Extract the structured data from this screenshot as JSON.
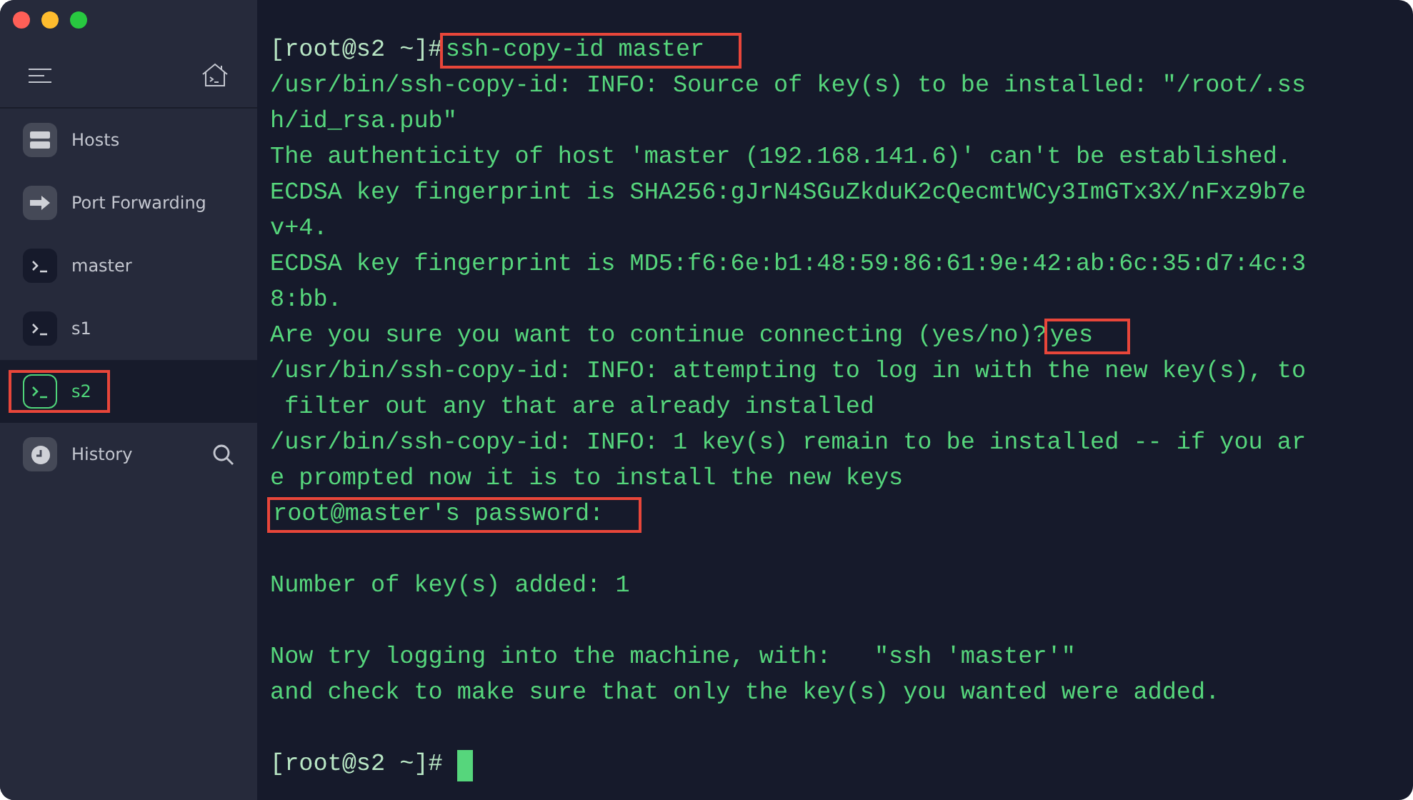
{
  "sidebar": {
    "items": [
      {
        "kind": "hosts",
        "label": "Hosts",
        "selected": false,
        "highlighted": false
      },
      {
        "kind": "forwarding",
        "label": "Port Forwarding",
        "selected": false,
        "highlighted": false
      },
      {
        "kind": "terminal",
        "label": "master",
        "selected": false,
        "highlighted": false
      },
      {
        "kind": "terminal",
        "label": "s1",
        "selected": false,
        "highlighted": false
      },
      {
        "kind": "terminal",
        "label": "s2",
        "selected": true,
        "highlighted": true
      },
      {
        "kind": "history",
        "label": "History",
        "selected": false,
        "highlighted": false
      }
    ]
  },
  "terminal": {
    "lines": [
      {
        "kind": "text",
        "segments": [
          {
            "text": "[root@s2 ~]#",
            "highlighted": false
          },
          {
            "text": "ssh-copy-id master",
            "highlighted": true
          }
        ]
      },
      {
        "kind": "text",
        "segments": [
          {
            "text": "/usr/bin/ssh-copy-id: INFO: Source of key(s) to be installed: \"/root/.ss",
            "highlighted": false
          }
        ]
      },
      {
        "kind": "text",
        "segments": [
          {
            "text": "h/id_rsa.pub\"",
            "highlighted": false
          }
        ]
      },
      {
        "kind": "text",
        "segments": [
          {
            "text": "The authenticity of host 'master (192.168.141.6)' can't be established.",
            "highlighted": false
          }
        ]
      },
      {
        "kind": "text",
        "segments": [
          {
            "text": "ECDSA key fingerprint is SHA256:gJrN4SGuZkduK2cQecmtWCy3ImGTx3X/nFxz9b7e",
            "highlighted": false
          }
        ]
      },
      {
        "kind": "text",
        "segments": [
          {
            "text": "v+4.",
            "highlighted": false
          }
        ]
      },
      {
        "kind": "text",
        "segments": [
          {
            "text": "ECDSA key fingerprint is MD5:f6:6e:b1:48:59:86:61:9e:42:ab:6c:35:d7:4c:3",
            "highlighted": false
          }
        ]
      },
      {
        "kind": "text",
        "segments": [
          {
            "text": "8:bb.",
            "highlighted": false
          }
        ]
      },
      {
        "kind": "text",
        "segments": [
          {
            "text": "Are you sure you want to continue connecting (yes/no)?",
            "highlighted": false
          },
          {
            "text": "yes",
            "highlighted": true
          }
        ]
      },
      {
        "kind": "text",
        "segments": [
          {
            "text": "/usr/bin/ssh-copy-id: INFO: attempting to log in with the new key(s), to",
            "highlighted": false
          }
        ]
      },
      {
        "kind": "text",
        "segments": [
          {
            "text": " filter out any that are already installed",
            "highlighted": false
          }
        ]
      },
      {
        "kind": "text",
        "segments": [
          {
            "text": "/usr/bin/ssh-copy-id: INFO: 1 key(s) remain to be installed -- if you ar",
            "highlighted": false
          }
        ]
      },
      {
        "kind": "text",
        "segments": [
          {
            "text": "e prompted now it is to install the new keys",
            "highlighted": false
          }
        ]
      },
      {
        "kind": "text",
        "segments": [
          {
            "text": "root@master's password:",
            "highlighted": true
          }
        ]
      },
      {
        "kind": "blank"
      },
      {
        "kind": "text",
        "segments": [
          {
            "text": "Number of key(s) added: 1",
            "highlighted": false
          }
        ]
      },
      {
        "kind": "blank"
      },
      {
        "kind": "text",
        "segments": [
          {
            "text": "Now try logging into the machine, with:   \"ssh 'master'\"",
            "highlighted": false
          }
        ]
      },
      {
        "kind": "text",
        "segments": [
          {
            "text": "and check to make sure that only the key(s) you wanted were added.",
            "highlighted": false
          }
        ]
      },
      {
        "kind": "blank"
      },
      {
        "kind": "prompt",
        "segments": [
          {
            "text": "[root@s2 ~]#",
            "highlighted": false
          }
        ],
        "cursor": true
      }
    ]
  }
}
